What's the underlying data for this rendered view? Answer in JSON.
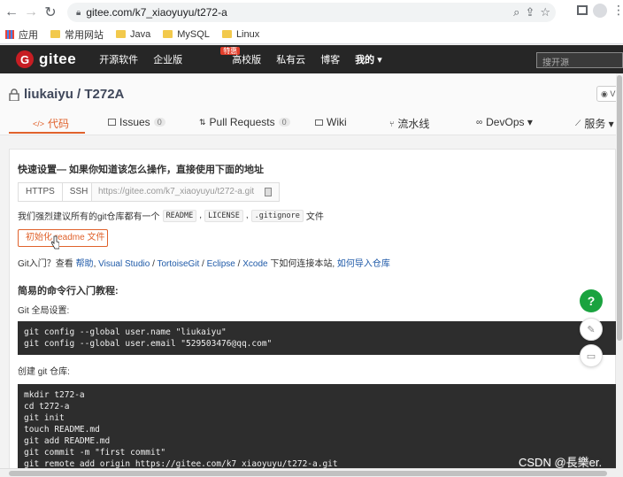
{
  "browser": {
    "url": "gitee.com/k7_xiaoyuyu/t272-a",
    "bookmarks": [
      {
        "label": "应用"
      },
      {
        "label": "常用网站"
      },
      {
        "label": "Java"
      },
      {
        "label": "MySQL"
      },
      {
        "label": "Linux"
      }
    ]
  },
  "header": {
    "logo": "gitee",
    "nav": [
      "开源软件",
      "企业版",
      "高校版",
      "私有云",
      "博客",
      "我的 ▾"
    ],
    "badge": "特惠",
    "search_placeholder": "搜开源"
  },
  "repo": {
    "title": "liukaiyu / T272A",
    "watch": "◉ V",
    "tabs": [
      {
        "label": "代码",
        "icon": "</>"
      },
      {
        "label": "Issues",
        "count": "0"
      },
      {
        "label": "Pull Requests",
        "count": "0"
      },
      {
        "label": "Wiki"
      },
      {
        "label": "流水线"
      },
      {
        "label": "DevOps ▾"
      },
      {
        "label": "服务 ▾"
      }
    ]
  },
  "main": {
    "quick_setup_title": "快速设置— 如果你知道该怎么操作，直接使用下面的地址",
    "proto_https": "HTTPS",
    "proto_ssh": "SSH",
    "clone_url": "https://gitee.com/k7_xiaoyuyu/t272-a.git",
    "recommend_prefix": "我们强烈建议所有的git仓库都有一个",
    "chips": [
      "README",
      "LICENSE",
      ".gitignore"
    ],
    "recommend_suffix": "文件",
    "init_button": "初始化 readme 文件",
    "git_help_prefix": "Git入门？查看",
    "git_help_links": [
      "帮助",
      "Visual Studio",
      "TortoiseGit",
      "Eclipse",
      "Xcode"
    ],
    "git_help_middle": "下如何连接本站,",
    "git_help_import": "如何导入仓库",
    "easy_title": "简易的命令行入门教程:",
    "global_label": "Git 全局设置:",
    "global_code": "git config --global user.name \"liukaiyu\"\ngit config --global user.email \"529503476@qq.com\"",
    "create_label": "创建 git 仓库:",
    "create_code": "mkdir t272-a\ncd t272-a\ngit init\ntouch README.md\ngit add README.md\ngit commit -m \"first commit\"\ngit remote add origin https://gitee.com/k7_xiaoyuyu/t272-a.git"
  },
  "float": {
    "help": "?"
  },
  "watermark": "CSDN @長樂er."
}
